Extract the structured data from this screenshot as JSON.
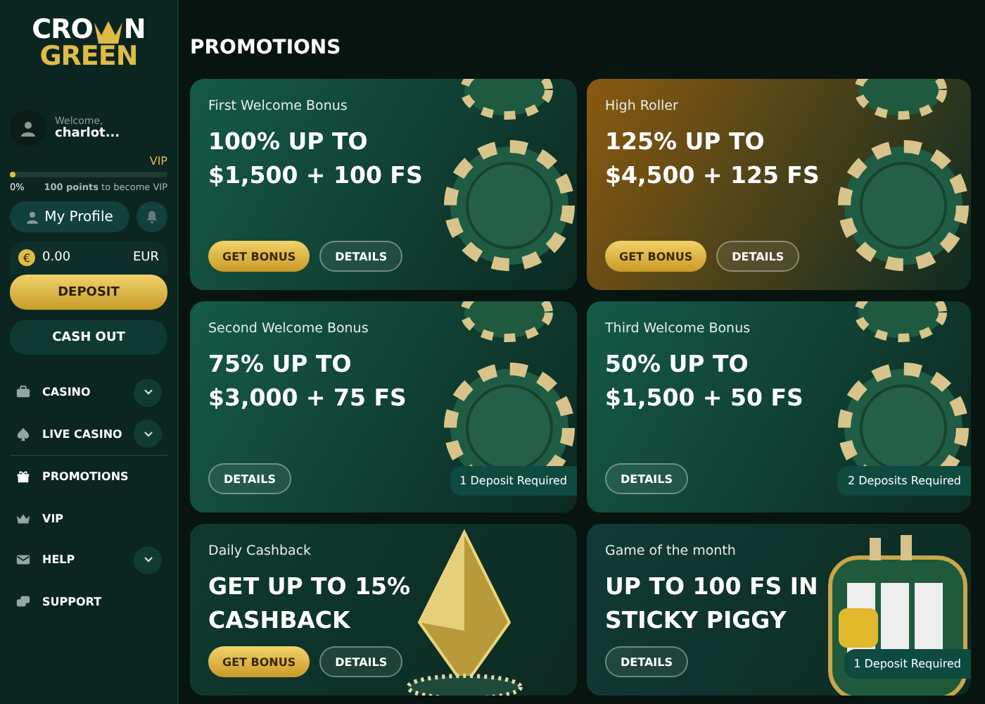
{
  "sidebar": {
    "logo": {
      "top": "CRO",
      "top_end": "N",
      "bottom": "GREEN"
    },
    "user": {
      "greeting": "Welcome,",
      "name": "charlot..."
    },
    "vip": {
      "label": "VIP",
      "level": 0.02,
      "percent": "0%",
      "hint": "**100 points** to become VIP"
    },
    "profile_button": "My Profile",
    "balance": {
      "currency_symbol": "€",
      "amount": "0.00",
      "currency": "EUR"
    },
    "deposit_button": "DEPOSIT",
    "cashout_button": "CASH OUT",
    "nav": [
      {
        "label": "CASINO",
        "kind": "briefcase",
        "expandable": true
      },
      {
        "label": "LIVE CASINO",
        "kind": "spade",
        "expandable": true
      },
      {
        "label": "PROMOTIONS",
        "kind": "gift",
        "expandable": false
      },
      {
        "label": "VIP",
        "kind": "crown",
        "expandable": false
      },
      {
        "label": "HELP",
        "kind": "mail",
        "expandable": true
      },
      {
        "label": "SUPPORT",
        "kind": "chat",
        "expandable": false
      }
    ]
  },
  "page_title": "PROMOTIONS",
  "promotions": [
    {
      "subtitle": "First Welcome Bonus",
      "headline": [
        "100% UP TO",
        "$1,500 + 100 FS"
      ],
      "get_bonus": "GET BONUS",
      "details": "DETAILS",
      "kind": "chip",
      "color": "#155a48"
    },
    {
      "subtitle": "High Roller",
      "headline": [
        "125% UP TO",
        "$4,500 + 125 FS"
      ],
      "get_bonus": "GET BONUS",
      "details": "DETAILS",
      "kind": "chip",
      "color": "#8a5a10"
    },
    {
      "subtitle": "Second Welcome Bonus",
      "headline": [
        "75% UP TO",
        "$3,000 + 75 FS"
      ],
      "details": "DETAILS",
      "badge": "1 Deposit Required",
      "kind": "chip",
      "color": "#155a48"
    },
    {
      "subtitle": "Third Welcome Bonus",
      "headline": [
        "50% UP TO",
        "$1,500 + 50 FS"
      ],
      "details": "DETAILS",
      "badge": "2 Deposits Required",
      "kind": "chip",
      "color": "#155a48"
    },
    {
      "subtitle": "Daily Cashback",
      "headline": [
        "GET UP TO 15%",
        "CASHBACK"
      ],
      "get_bonus": "GET BONUS",
      "details": "DETAILS",
      "kind": "diamond",
      "color": "#0f3a30"
    },
    {
      "subtitle": "Game of the month",
      "headline": [
        "UP TO 100 FS IN",
        "STICKY PIGGY"
      ],
      "details": "DETAILS",
      "badge": "1 Deposit Required",
      "kind": "slot",
      "color": "#123a34"
    }
  ]
}
